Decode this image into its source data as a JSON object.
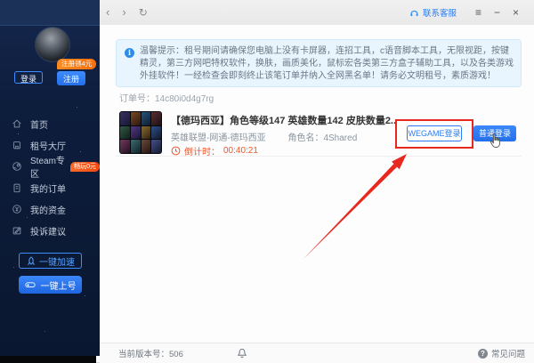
{
  "titlebar": {
    "back": "‹",
    "forward": "›",
    "refresh": "↻",
    "contact": "联系客服",
    "menu_glyph": "≡",
    "minimize_glyph": "−",
    "close_glyph": "×"
  },
  "sidebar": {
    "register_badge": "注册领4元",
    "login_button": "登录",
    "register_button": "注册",
    "menu": [
      {
        "label": "首页"
      },
      {
        "label": "租号大厅"
      },
      {
        "label": "Steam专区",
        "badge": "畅玩0元"
      },
      {
        "label": "我的订单"
      },
      {
        "label": "我的资金"
      },
      {
        "label": "投诉建议"
      }
    ],
    "boost_button": "一键加速",
    "onekey_button": "一键上号"
  },
  "notice": {
    "info_glyph": "i",
    "text": "温馨提示：租号期间请确保您电脑上没有卡屏器，连招工具，c语音脚本工具，无限视距，按键精灵，第三方网吧特权软件，换肤，画质美化，鼠标宏各类第三方盒子辅助工具，以及各类游戏外挂软件！一经检查会即刻终止该笔订单并纳入全网黑名单！请务必文明租号，素质游戏！"
  },
  "order": {
    "order_no": "订单号：14c80i0d4g7rg",
    "title": "【德玛西亚】角色等级147 英雄数量142 皮肤数量2..",
    "server": "英雄联盟-网通-德玛西亚",
    "role": "角色名：4Shared",
    "countdown_label": "倒计时：",
    "countdown": "00:40:21",
    "wegame_login": "WEGAME登录",
    "normal_login": "普通登录"
  },
  "statusbar": {
    "version": "当前版本号：506",
    "faq": "常见问题",
    "question_glyph": "?"
  },
  "colors": {
    "accent": "#2b7cf0",
    "danger": "#e8281e",
    "timer": "#f2552a",
    "badge-orange": "#f97316"
  }
}
